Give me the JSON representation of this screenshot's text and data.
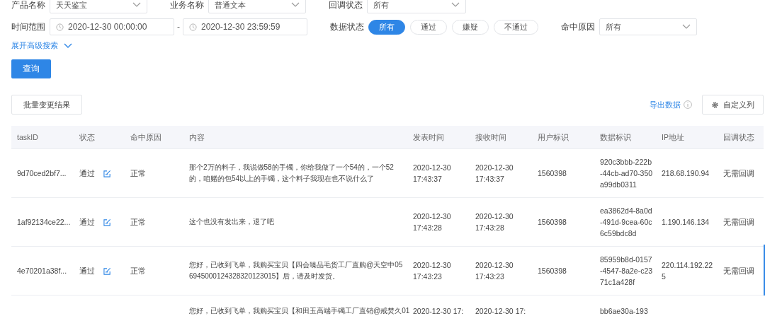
{
  "filters": {
    "product": {
      "label": "产品名称",
      "value": "天天鉴宝"
    },
    "business": {
      "label": "业务名称",
      "value": "普通文本"
    },
    "callback": {
      "label": "回调状态",
      "value": "所有"
    },
    "time_range": {
      "label": "时间范围",
      "start": "2020-12-30 00:00:00",
      "separator": "-",
      "end": "2020-12-30 23:59:59"
    },
    "data_status": {
      "label": "数据状态",
      "options": [
        {
          "label": "所有",
          "selected": true
        },
        {
          "label": "通过",
          "selected": false
        },
        {
          "label": "嫌疑",
          "selected": false
        },
        {
          "label": "不通过",
          "selected": false
        }
      ]
    },
    "hit_reason": {
      "label": "命中原因",
      "value": "所有"
    },
    "advanced_search": "展开高级搜索",
    "query_button": "查询"
  },
  "toolbar": {
    "batch_button": "批量变更结果",
    "export_link": "导出数据",
    "columns_button": "自定义列"
  },
  "table": {
    "columns": [
      "taskID",
      "状态",
      "命中原因",
      "内容",
      "发表时间",
      "接收时间",
      "用户标识",
      "数据标识",
      "IP地址",
      "回调状态"
    ],
    "rows": [
      {
        "task_id": "9d70ced2bf7...",
        "status": "通过",
        "reason": "正常",
        "content": "那个2万的料子，我说做58的手镯，你给我做了一个54的，一个52的，咱赌的包54以上的手镯，这个料子我现在也不说什么了",
        "publish_time": "2020-12-30 17:43:37",
        "receive_time": "2020-12-30 17:43:37",
        "user_id": "1560398",
        "data_id": "920c3bbb-222b-44cb-ad70-350a99db0311",
        "ip": "218.68.190.94",
        "callback": "无需回调"
      },
      {
        "task_id": "1af92134ce22...",
        "status": "通过",
        "reason": "正常",
        "content": "这个也没有发出来，退了吧",
        "publish_time": "2020-12-30 17:43:28",
        "receive_time": "2020-12-30 17:43:28",
        "user_id": "1560398",
        "data_id": "ea3862d4-8a0d-491d-9cea-60c6c59bdc8d",
        "ip": "1.190.146.134",
        "callback": "无需回调"
      },
      {
        "task_id": "4e70201a38f...",
        "status": "通过",
        "reason": "正常",
        "content": "您好，已收到飞单，我购买宝贝【四会臻品毛货工厂直购@天空中056945000124328320123015】后，请及时发货。",
        "publish_time": "2020-12-30 17:43:23",
        "receive_time": "2020-12-30 17:43:23",
        "user_id": "1560398",
        "data_id": "85959b8d-0157-4547-8a2e-c2371c1a428f",
        "ip": "220.114.192.225",
        "callback": "无需回调"
      },
      {
        "content": "您好，已收到飞单，我购买宝贝【和田玉高端手镯工厂直销@戒焚久01",
        "publish_time": "2020-12-30 17:",
        "receive_time": "2020-12-30 17:",
        "data_id": "bb6ae30a-193"
      }
    ]
  }
}
